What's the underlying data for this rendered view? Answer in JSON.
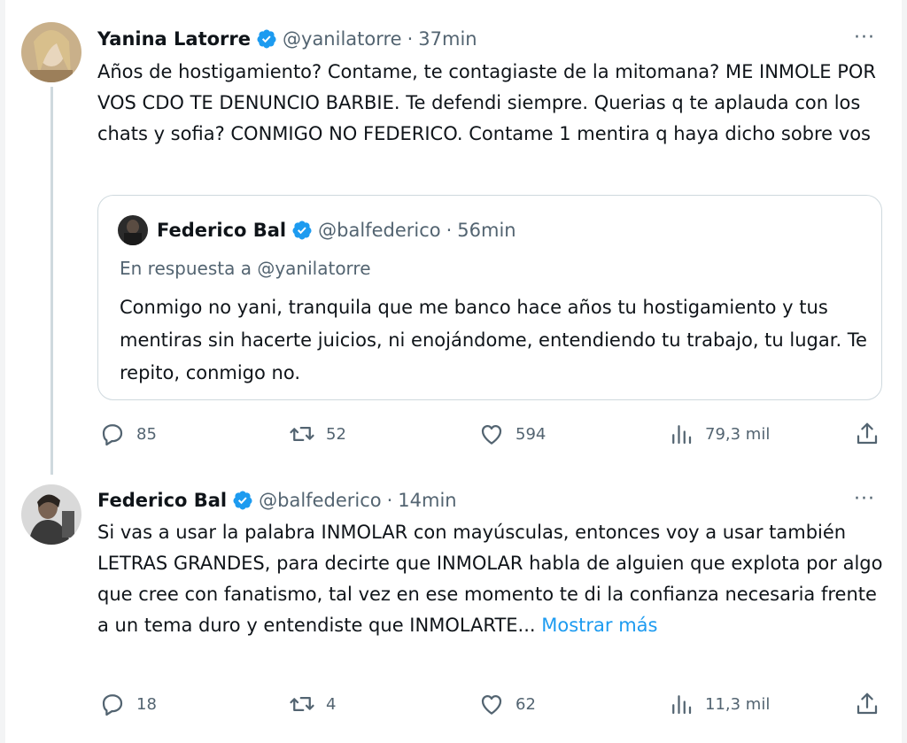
{
  "tweets": [
    {
      "name": "Yanina Latorre",
      "handle": "@yanilatorre",
      "separator": "·",
      "time": "37min",
      "text": "Años de hostigamiento? Contame, te contagiaste de la mitomana? ME INMOLE POR VOS CDO TE DENUNCIO BARBIE. Te defendi siempre. Querias q te aplauda con los chats y sofia? CONMIGO NO FEDERICO. Contame 1 mentira q haya dicho sobre vos",
      "more": "···",
      "quote": {
        "name": "Federico Bal",
        "handle": "@balfederico",
        "separator": "·",
        "time": "56min",
        "reply_to": "En respuesta a @yanilatorre",
        "text": "Conmigo no yani, tranquila que me banco hace años tu hostigamiento y tus mentiras sin hacerte juicios, ni enojándome, entendiendo tu trabajo, tu lugar. Te repito, conmigo no."
      },
      "stats": {
        "replies": "85",
        "retweets": "52",
        "likes": "594",
        "views": "79,3 mil"
      }
    },
    {
      "name": "Federico Bal",
      "handle": "@balfederico",
      "separator": "·",
      "time": "14min",
      "text": "Si vas a usar la palabra INMOLAR con mayúsculas, entonces voy a usar también LETRAS GRANDES, para decirte que INMOLAR habla de alguien que explota por algo que cree con fanatismo, tal vez en ese momento te di la confianza necesaria frente a un tema duro y entendiste que INMOLARTE...",
      "show_more": "Mostrar más",
      "more": "···",
      "stats": {
        "replies": "18",
        "retweets": "4",
        "likes": "62",
        "views": "11,3 mil"
      }
    }
  ],
  "icons": {
    "reply": "speech-bubble-icon",
    "retweet": "retweet-icon",
    "like": "heart-icon",
    "views": "bar-chart-icon",
    "share": "share-icon",
    "verified": "verified-badge-icon",
    "more": "more-dots-icon"
  },
  "colors": {
    "verified": "#1d9bf0",
    "secondary": "#536471",
    "link": "#1d9bf0",
    "border": "#cfd9de"
  }
}
